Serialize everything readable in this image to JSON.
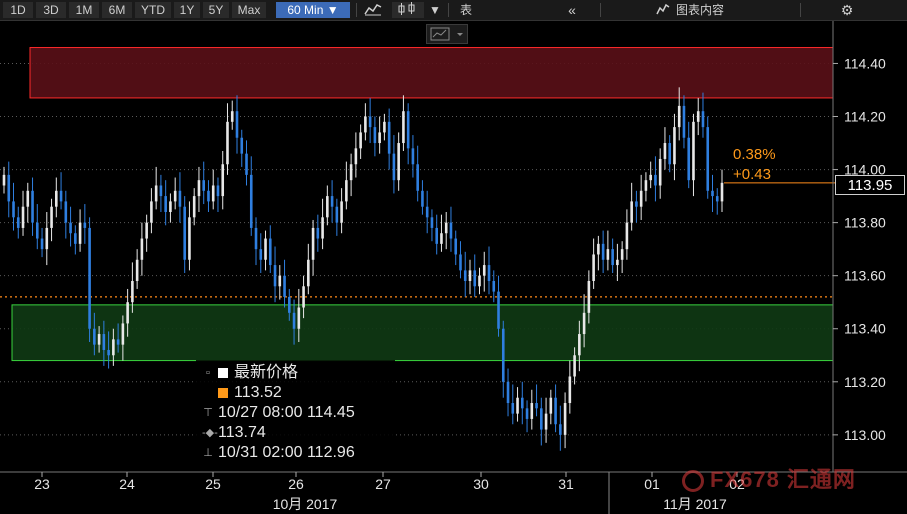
{
  "toolbar": {
    "ranges": [
      "1D",
      "3D",
      "1M",
      "6M",
      "YTD",
      "1Y",
      "5Y",
      "Max"
    ],
    "interval": "60 Min ▼",
    "table_label": "表",
    "chart_content_label": "图表内容"
  },
  "legend": {
    "title": "最新价格",
    "last": "113.52",
    "high": "10/27 08:00 114.45",
    "avg": "113.74",
    "low": "10/31 02:00 112.96"
  },
  "annotation": {
    "pct": "0.38%",
    "change": "+0.43"
  },
  "last_price_tag": "113.95",
  "watermark": "FX678 汇通网",
  "colors": {
    "up": "#e8e8e8",
    "down": "#2f7fe0",
    "resistance_zone": "#5a0f17",
    "resistance_border": "#ff2a2a",
    "support_zone": "#0f3a14",
    "support_border": "#39d43e",
    "last_line": "#ff8c1a",
    "grid": "#5a5a5a"
  },
  "chart_data": {
    "type": "candlestick",
    "ylim": [
      112.86,
      114.56
    ],
    "yticks": [
      113.0,
      113.2,
      113.4,
      113.6,
      113.8,
      114.0,
      114.2,
      114.4
    ],
    "ytick_labels": [
      "113.00",
      "113.20",
      "113.40",
      "113.60",
      "113.80",
      "114.00",
      "114.20",
      "114.40"
    ],
    "day_ticks": [
      "23",
      "24",
      "25",
      "26",
      "27",
      "30",
      "31",
      "01",
      "02"
    ],
    "month_labels": [
      "10月 2017",
      "11月 2017"
    ],
    "zones": [
      {
        "name": "resistance",
        "from": 114.27,
        "to": 114.46
      },
      {
        "name": "support",
        "from": 113.28,
        "to": 113.49
      }
    ],
    "last_price": 113.95,
    "reference_price": 113.52,
    "stats": {
      "last": 113.52,
      "high": 114.45,
      "average": 113.74,
      "low": 112.96
    },
    "closes": [
      113.98,
      113.88,
      113.82,
      113.78,
      113.86,
      113.92,
      113.8,
      113.74,
      113.7,
      113.78,
      113.86,
      113.92,
      113.88,
      113.8,
      113.76,
      113.72,
      113.8,
      113.78,
      113.4,
      113.34,
      113.38,
      113.32,
      113.3,
      113.36,
      113.34,
      113.42,
      113.5,
      113.58,
      113.66,
      113.74,
      113.8,
      113.88,
      113.94,
      113.9,
      113.84,
      113.88,
      113.92,
      113.86,
      113.66,
      113.82,
      113.9,
      113.96,
      113.92,
      113.88,
      113.94,
      113.9,
      114.02,
      114.18,
      114.22,
      114.12,
      114.06,
      113.98,
      113.78,
      113.7,
      113.66,
      113.74,
      113.64,
      113.56,
      113.6,
      113.52,
      113.46,
      113.4,
      113.48,
      113.56,
      113.66,
      113.78,
      113.74,
      113.82,
      113.9,
      113.86,
      113.8,
      113.88,
      113.96,
      114.02,
      114.08,
      114.14,
      114.2,
      114.16,
      114.1,
      114.14,
      114.18,
      114.06,
      113.96,
      114.1,
      114.22,
      114.08,
      114.02,
      113.92,
      113.86,
      113.82,
      113.78,
      113.72,
      113.76,
      113.8,
      113.74,
      113.68,
      113.62,
      113.58,
      113.62,
      113.56,
      113.6,
      113.64,
      113.58,
      113.54,
      113.4,
      113.2,
      113.12,
      113.08,
      113.14,
      113.1,
      113.06,
      113.12,
      113.1,
      113.02,
      113.08,
      113.14,
      113.04,
      113.0,
      113.12,
      113.22,
      113.3,
      113.38,
      113.46,
      113.58,
      113.68,
      113.72,
      113.66,
      113.7,
      113.64,
      113.66,
      113.7,
      113.8,
      113.88,
      113.86,
      113.92,
      113.96,
      113.98,
      113.94,
      114.04,
      114.1,
      114.02,
      114.16,
      114.24,
      114.12,
      113.96,
      114.18,
      114.22,
      114.16,
      113.92,
      113.9,
      113.88,
      113.95
    ]
  }
}
